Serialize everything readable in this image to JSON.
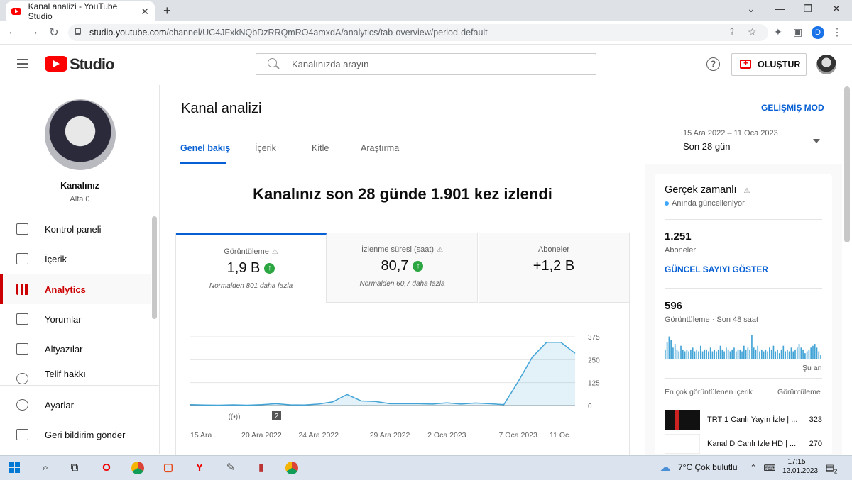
{
  "browser": {
    "tab_title": "Kanal analizi - YouTube Studio",
    "tab_close": "✕",
    "new_tab": "+",
    "url_host": "studio.youtube.com",
    "url_path": "/channel/UC4JFxkNQbDzRRQmRO4amxdA/analytics/tab-overview/period-default",
    "profile_letter": "D",
    "win_min": "⌄",
    "win_minimize": "—",
    "win_restore": "❐",
    "win_close": "✕",
    "back": "←",
    "forward": "→",
    "reload": "↻",
    "share_icon": "⇪",
    "star_icon": "☆",
    "ext_icon": "✦",
    "side_icon": "▣",
    "menu_icon": "⋮"
  },
  "header": {
    "logo_text": "Studio",
    "search_placeholder": "Kanalınızda arayın",
    "help": "?",
    "create_label": "OLUŞTUR"
  },
  "sidebar": {
    "channel_name": "Kanalınız",
    "channel_sub": "Alfa 0",
    "items": [
      {
        "label": "Kontrol paneli"
      },
      {
        "label": "İçerik"
      },
      {
        "label": "Analytics"
      },
      {
        "label": "Yorumlar"
      },
      {
        "label": "Altyazılar"
      },
      {
        "label": "Telif hakkı"
      },
      {
        "label": "Ayarlar"
      },
      {
        "label": "Geri bildirim gönder"
      }
    ]
  },
  "main": {
    "title": "Kanal analizi",
    "advanced_mode": "GELİŞMİŞ MOD",
    "tabs": [
      {
        "label": "Genel bakış"
      },
      {
        "label": "İçerik"
      },
      {
        "label": "Kitle"
      },
      {
        "label": "Araştırma"
      }
    ],
    "date_range": "15 Ara 2022 – 11 Oca 2023",
    "period": "Son 28 gün",
    "headline": "Kanalınız son 28 günde 1.901 kez izlendi",
    "metrics": [
      {
        "label": "Görüntüleme",
        "value": "1,9 B",
        "note": "Normalden 801 daha fazla"
      },
      {
        "label": "İzlenme süresi (saat)",
        "value": "80,7",
        "note": "Normalden 60,7 daha fazla"
      },
      {
        "label": "Aboneler",
        "value": "+1,2 B",
        "note": ""
      }
    ]
  },
  "chart_data": {
    "type": "area",
    "x": [
      "15 Ara 2022",
      "16 Ara 2022",
      "17 Ara 2022",
      "18 Ara 2022",
      "19 Ara 2022",
      "20 Ara 2022",
      "21 Ara 2022",
      "22 Ara 2022",
      "23 Ara 2022",
      "24 Ara 2022",
      "25 Ara 2022",
      "26 Ara 2022",
      "27 Ara 2022",
      "28 Ara 2022",
      "29 Ara 2022",
      "30 Ara 2022",
      "31 Ara 2022",
      "1 Oca 2023",
      "2 Oca 2023",
      "3 Oca 2023",
      "4 Oca 2023",
      "5 Oca 2023",
      "6 Oca 2023",
      "7 Oca 2023",
      "8 Oca 2023",
      "9 Oca 2023",
      "10 Oca 2023",
      "11 Oca 2023"
    ],
    "values": [
      5,
      3,
      2,
      4,
      2,
      5,
      10,
      4,
      3,
      8,
      20,
      60,
      25,
      22,
      10,
      10,
      10,
      8,
      15,
      8,
      14,
      10,
      5,
      130,
      265,
      345,
      345,
      285
    ],
    "tick_labels": [
      "15 Ara ...",
      "20 Ara 2022",
      "24 Ara 2022",
      "29 Ara 2022",
      "2 Oca 2023",
      "7 Oca 2023",
      "11 Oc..."
    ],
    "y_ticks": [
      "375",
      "250",
      "125",
      "0"
    ],
    "ylim": [
      0,
      375
    ],
    "marker_label": "2",
    "color": "#41a3d6"
  },
  "realtime": {
    "title": "Gerçek zamanlı",
    "updating": "Anında güncelleniyor",
    "subs_count": "1.251",
    "subs_label": "Aboneler",
    "show_live": "GÜNCEL SAYIYI GÖSTER",
    "views_count": "596",
    "views_label": "Görüntüleme · Son 48 saat",
    "now_label": "Şu an",
    "top_content_label": "En çok görüntülenen içerik",
    "top_views_label": "Görüntüleme",
    "bars": [
      5,
      9,
      12,
      10,
      6,
      8,
      5,
      4,
      7,
      5,
      4,
      5,
      4,
      5,
      6,
      4,
      5,
      4,
      7,
      4,
      5,
      5,
      4,
      6,
      4,
      5,
      4,
      5,
      7,
      5,
      4,
      6,
      5,
      4,
      5,
      6,
      4,
      5,
      5,
      4,
      7,
      5,
      6,
      5,
      13,
      6,
      5,
      7,
      4,
      5,
      4,
      5,
      4,
      6,
      5,
      7,
      4,
      5,
      3,
      5,
      7,
      4,
      5,
      4,
      6,
      4,
      5,
      6,
      8,
      6,
      5,
      3,
      4,
      5,
      6,
      7,
      8,
      6,
      4,
      2
    ],
    "videos": [
      {
        "title": "TRT 1 Canlı Yayın İzle | ...",
        "count": "323"
      },
      {
        "title": "Kanal D Canlı İzle HD | ...",
        "count": "270"
      }
    ]
  },
  "taskbar": {
    "weather": "7°C  Çok bulutlu",
    "time": "17:15",
    "date": "12.01.2023",
    "notif": "2"
  }
}
